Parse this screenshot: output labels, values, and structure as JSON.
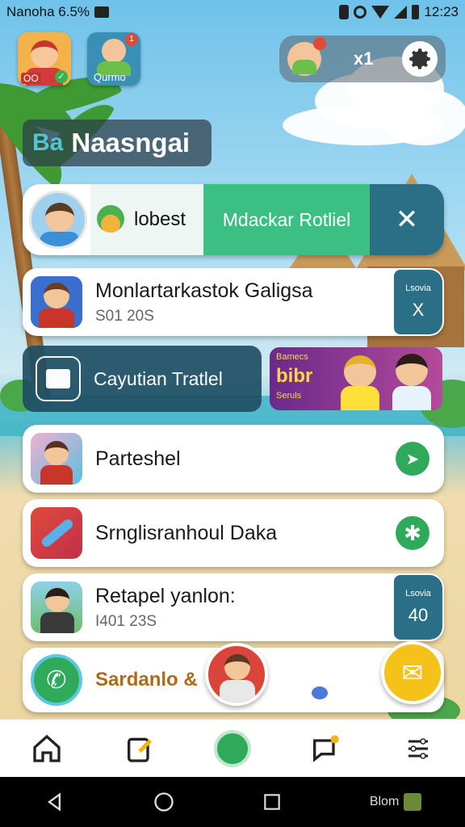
{
  "status_bar": {
    "left_text": "Nanoha 6.5%",
    "time": "12:23"
  },
  "apps": {
    "left_app_label": "OO",
    "second_app_label": "Qurmo",
    "second_app_badge": "1",
    "pill_text": "x1"
  },
  "section": {
    "prefix": "Ba",
    "title": "Naasngai"
  },
  "featured": {
    "label_left": "lobest",
    "label_green": "Mdackar Rotliel"
  },
  "cards": [
    {
      "title": "Monlartarkastok Galigsa",
      "sub": "S01 20S",
      "badge_top": "Lsovia",
      "badge_bottom": "X"
    },
    {
      "title": "Parteshel"
    },
    {
      "title": "Srnglisranhoul Daka"
    },
    {
      "title": "Retapel yanlon:",
      "sub": "I401 23S",
      "badge_top": "Lsovia",
      "badge_bottom": "40"
    }
  ],
  "dark_banner": {
    "title": "Cayutian Tratlel",
    "promo_top": "Bamecs",
    "promo_main": "bibr",
    "promo_sub": "Seruls"
  },
  "bottom_card": {
    "title": "Sardanlo &"
  },
  "system_bar": {
    "right_label": "Blom"
  },
  "colors": {
    "green": "#2eaa5a",
    "teal": "#2b6f86",
    "dark_banner": "#1f4f64"
  }
}
